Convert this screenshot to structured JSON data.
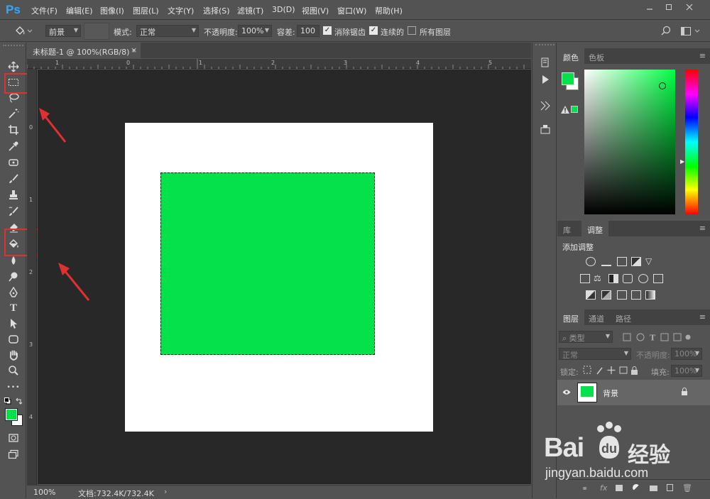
{
  "app": {
    "logo": "Ps"
  },
  "menu": [
    "文件(F)",
    "编辑(E)",
    "图像(I)",
    "图层(L)",
    "文字(Y)",
    "选择(S)",
    "滤镜(T)",
    "3D(D)",
    "视图(V)",
    "窗口(W)",
    "帮助(H)"
  ],
  "options": {
    "fill_source": "前景",
    "mode_label": "模式:",
    "mode_value": "正常",
    "opacity_label": "不透明度:",
    "opacity_value": "100%",
    "tolerance_label": "容差:",
    "tolerance_value": "100",
    "antialias_label": "消除锯齿",
    "antialias_checked": true,
    "contiguous_label": "连续的",
    "contiguous_checked": true,
    "all_layers_label": "所有图层",
    "all_layers_checked": false
  },
  "document": {
    "tab_title": "未标题-1 @ 100%(RGB/8) *",
    "ruler_top": [
      "1",
      "0",
      "1",
      "2",
      "3",
      "4",
      "5",
      "6"
    ],
    "ruler_left": [
      "0",
      "1",
      "2",
      "3",
      "4"
    ],
    "fill_color": "#05e14a",
    "canvas_color": "#ffffff"
  },
  "status": {
    "zoom": "100%",
    "doc_info": "文档:732.4K/732.4K"
  },
  "toolbox": {
    "tools": [
      "move-tool",
      "rectangular-marquee-tool",
      "lasso-tool",
      "magic-wand-tool",
      "crop-tool",
      "eyedropper-tool",
      "spot-healing-tool",
      "brush-tool",
      "clone-stamp-tool",
      "history-brush-tool",
      "eraser-tool",
      "paint-bucket-tool",
      "blur-tool",
      "dodge-tool",
      "pen-tool",
      "type-tool",
      "path-selection-tool",
      "rectangle-tool",
      "hand-tool",
      "zoom-tool",
      "more-tools"
    ],
    "type_glyph": "T",
    "more_glyph": "•••",
    "foreground": "#05e14a",
    "background": "#ffffff",
    "highlighted": [
      "rectangular-marquee-tool",
      "paint-bucket-tool"
    ]
  },
  "panels": {
    "color_tabs": [
      "颜色",
      "色板"
    ],
    "adjust_tabs": [
      "库",
      "调整"
    ],
    "adjust_title": "添加调整",
    "layers_tabs": [
      "图层",
      "通道",
      "路径"
    ],
    "layers_kind": "类型",
    "blend_mode": "正常",
    "layer_opacity_label": "不透明度:",
    "layer_opacity_value": "100%",
    "lock_label": "锁定:",
    "fill_label": "填充:",
    "fill_value": "100%",
    "layers": [
      {
        "name": "背景",
        "thumb": "#05e14a",
        "visible": true,
        "locked": true
      }
    ],
    "layer_footer_glyph": "fx"
  },
  "watermark": {
    "brand": "Bai",
    "brand_cn": "经验",
    "url": "jingyan.baidu.com"
  }
}
